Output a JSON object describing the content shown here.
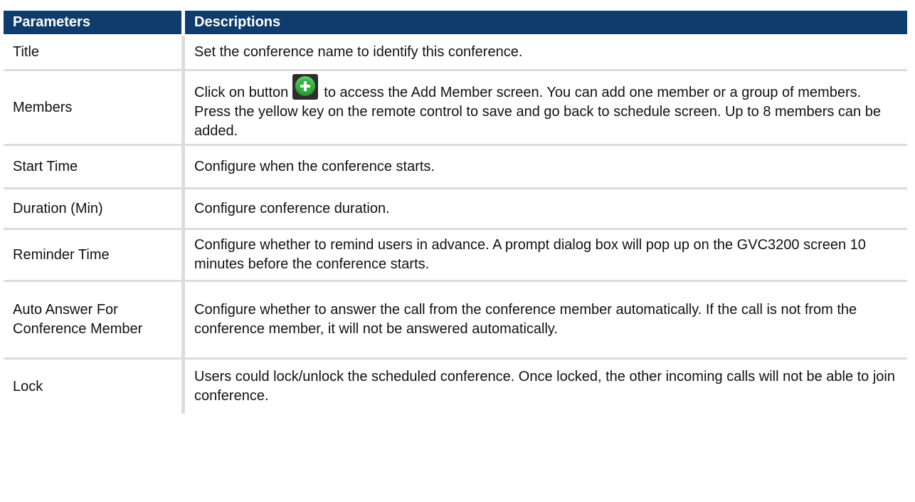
{
  "table": {
    "headers": {
      "parameters": "Parameters",
      "descriptions": "Descriptions"
    },
    "rows": [
      {
        "parameter": "Title",
        "description": "Set the conference name to identify this conference."
      },
      {
        "parameter": "Members",
        "description_before_icon": "Click on button",
        "icon": "add-green-plus-icon",
        "description_after_icon": "to access the Add Member screen. You can add one member or a group of members. Press the yellow key on the remote control to save and go back to schedule screen. Up to 8 members can be added."
      },
      {
        "parameter": "Start Time",
        "description": "Configure when the conference starts."
      },
      {
        "parameter": "Duration (Min)",
        "description": "Configure conference duration."
      },
      {
        "parameter": "Reminder Time",
        "description": "Configure whether to remind users in advance. A prompt dialog box will pop up on the GVC3200 screen 10 minutes before the conference starts."
      },
      {
        "parameter": "Auto Answer For Conference Member",
        "description": "Configure whether to answer the call from the conference member automatically. If the call is not from the conference member, it will not be answered automatically."
      },
      {
        "parameter": "Lock",
        "description": "Users could lock/unlock the scheduled conference. Once locked, the other incoming calls will not be able to join conference."
      }
    ]
  },
  "colors": {
    "header_bg": "#0e3c6c",
    "header_text": "#ffffff",
    "row_divider": "#dcdcdc",
    "plus_icon_green": "#2fb53a"
  }
}
